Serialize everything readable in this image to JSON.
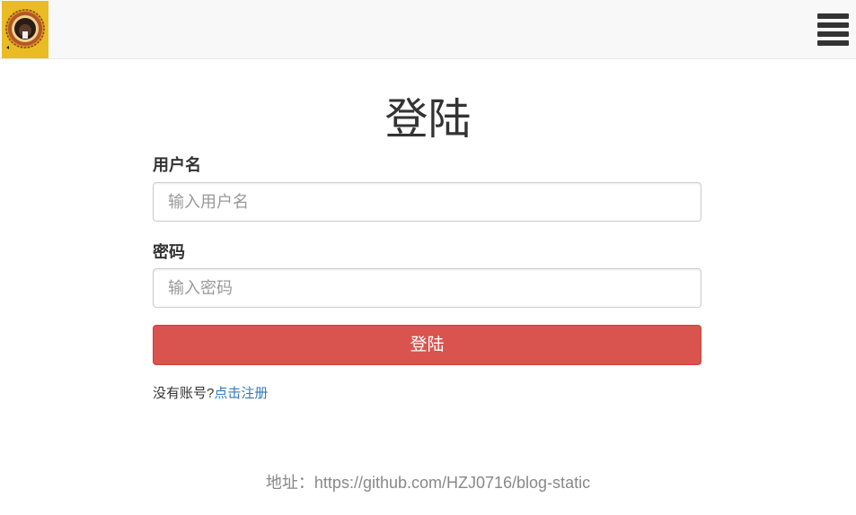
{
  "navbar": {
    "logo_icon": "site-logo-icon",
    "menu_icon": "hamburger-menu-icon"
  },
  "page": {
    "title": "登陆"
  },
  "form": {
    "username_label": "用户名",
    "username_placeholder": "输入用户名",
    "username_value": "",
    "password_label": "密码",
    "password_placeholder": "输入密码",
    "password_value": "",
    "submit_label": "登陆",
    "submit_color": "#d9534f"
  },
  "register": {
    "prompt": "没有账号?",
    "link_text": "点击注册",
    "link_color": "#337ab7"
  },
  "footer": {
    "address_label": "地址：",
    "address_url": "https://github.com/HZJ0716/blog-static"
  }
}
